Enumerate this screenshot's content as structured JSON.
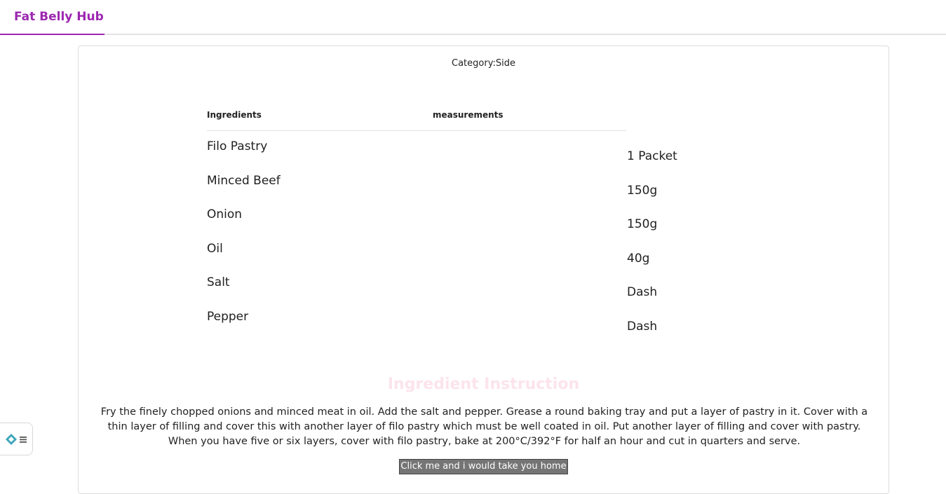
{
  "navbar": {
    "brand": "Fat Belly Hub"
  },
  "recipe": {
    "category_label": "Category:",
    "category_value": "Side",
    "table": {
      "col_ingredients": "Ingredients",
      "col_measurements": "measurements",
      "rows": [
        {
          "ingredient": "Filo Pastry",
          "measurement": "1 Packet"
        },
        {
          "ingredient": "Minced Beef",
          "measurement": "150g"
        },
        {
          "ingredient": "Onion",
          "measurement": "150g"
        },
        {
          "ingredient": "Oil",
          "measurement": "40g"
        },
        {
          "ingredient": "Salt",
          "measurement": "Dash"
        },
        {
          "ingredient": "Pepper",
          "measurement": "Dash"
        }
      ]
    },
    "instruction_title": "Ingredient Instruction",
    "instruction_text": "Fry the finely chopped onions and minced meat in oil. Add the salt and pepper. Grease a round baking tray and put a layer of pastry in it. Cover with a thin layer of filling and cover this with another layer of filo pastry which must be well coated in oil. Put another layer of filling and cover with pastry. When you have five or six layers, cover with filo pastry, bake at 200°C/392°F for half an hour and cut in quarters and serve.",
    "home_button_label": "Click me and i would take you home"
  },
  "widget": {
    "icon": "diamond-menu-icon",
    "accent": "#3aa6b9"
  },
  "colors": {
    "brand": "#9c27b0",
    "instruction_title": "#fce4ec",
    "button_bg": "#757575"
  }
}
